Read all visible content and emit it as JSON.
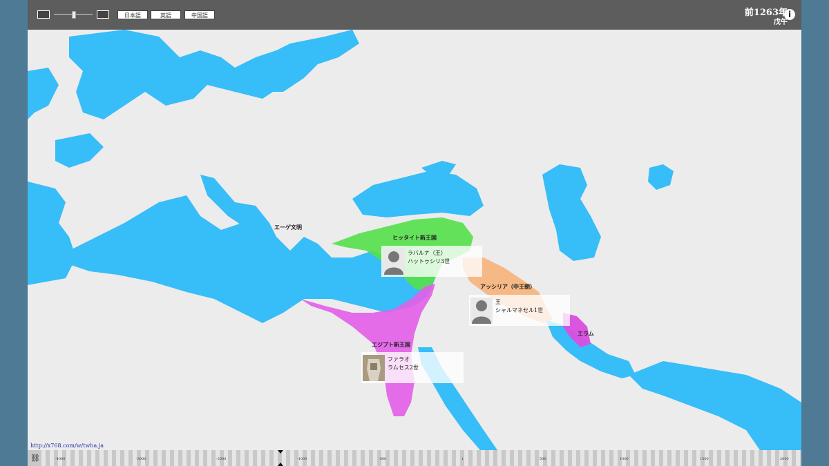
{
  "toolbar": {
    "languages": [
      "日本語",
      "英語",
      "中国語"
    ]
  },
  "year": {
    "main": "前1263年",
    "sub": "戊午"
  },
  "regions": [
    {
      "label": "エーゲ文明"
    },
    {
      "label": "ヒッタイト新王国"
    },
    {
      "label": "アッシリア（中王朝）"
    },
    {
      "label": "エラム"
    },
    {
      "label": "エジプト新王国"
    }
  ],
  "rulers": [
    {
      "line1": "ラバルナ（王）",
      "line2": "ハットゥシリ3世"
    },
    {
      "line1": "王",
      "line2": "シャルマネセル1世"
    },
    {
      "line1": "ファラオ",
      "line2": "ラムセス2世"
    }
  ],
  "footer": {
    "url": "http://x768.com/w/twha.ja"
  },
  "timeline": {
    "ticks": [
      "-4000",
      "-3000",
      "-2000",
      "-1000",
      "-500",
      "1",
      "500",
      "1000",
      "1500",
      "2000"
    ]
  },
  "colors": {
    "sea": "#37bdf8",
    "land": "#ececec",
    "hittite": "#55e04a",
    "assyria": "#f7b27a",
    "egypt": "#e35ee8",
    "elam": "#d94ee0"
  }
}
